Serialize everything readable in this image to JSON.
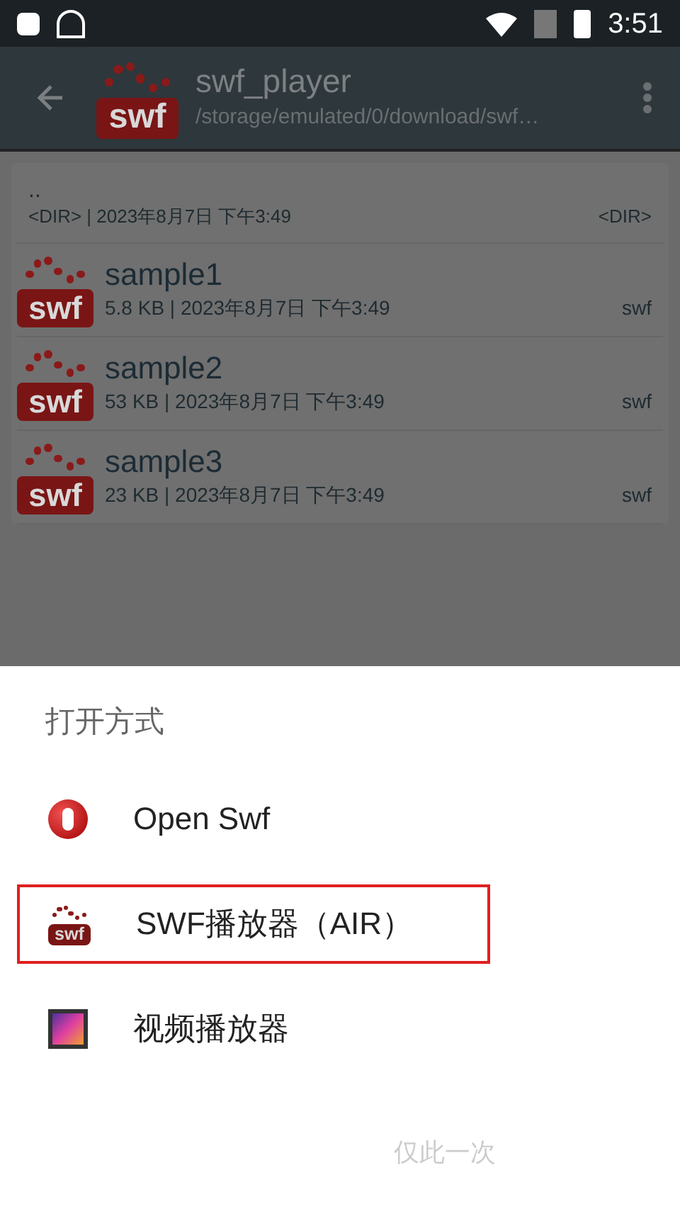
{
  "status_bar": {
    "time": "3:51"
  },
  "toolbar": {
    "logo_text": "swf",
    "title": "swf_player",
    "path": "/storage/emulated/0/download/swf…"
  },
  "parent_dir": {
    "name": "..",
    "details": "<DIR> | 2023年8月7日 下午3:49",
    "type": "<DIR>"
  },
  "files": [
    {
      "icon_text": "swf",
      "name": "sample1",
      "details": "5.8 KB | 2023年8月7日 下午3:49",
      "type": "swf"
    },
    {
      "icon_text": "swf",
      "name": "sample2",
      "details": "53 KB | 2023年8月7日 下午3:49",
      "type": "swf"
    },
    {
      "icon_text": "swf",
      "name": "sample3",
      "details": "23 KB | 2023年8月7日 下午3:49",
      "type": "swf"
    }
  ],
  "sheet": {
    "title": "打开方式",
    "apps": [
      {
        "kind": "openswf",
        "label": "Open Swf",
        "highlighted": false
      },
      {
        "kind": "swf",
        "icon_text": "swf",
        "label": "SWF播放器（AIR）",
        "highlighted": true
      },
      {
        "kind": "video",
        "label": "视频播放器",
        "highlighted": false
      }
    ],
    "buttons": [
      "仅此一次"
    ]
  }
}
